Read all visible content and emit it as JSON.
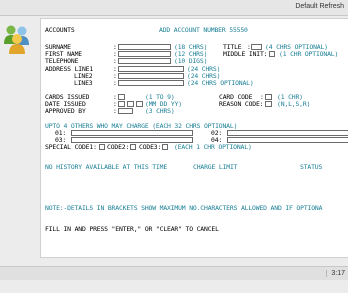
{
  "header": {
    "title": "Default Refresh"
  },
  "footer": {
    "time": "3:17"
  },
  "icon": {
    "name": "users-group-icon"
  },
  "screen": {
    "row_accounts": {
      "label": "ACCOUNTS",
      "info": "ADD ACCOUNT NUMBER 55550"
    },
    "surname": {
      "label": "SURNAME",
      "hint": "(18 CHRS)"
    },
    "title": {
      "label": "TITLE",
      "hint": "(4 CHRS OPTIONAL)"
    },
    "first_name": {
      "label": "FIRST NAME",
      "hint": "(12 CHRS)"
    },
    "middle_init": {
      "label": "MIDDLE INIT:",
      "hint": "(1 CHR OPTIONAL)"
    },
    "telephone": {
      "label": "TELEPHONE",
      "hint": "(10 DIGS)"
    },
    "address1": {
      "label": "ADDRESS LINE1",
      "hint": "(24 CHRS)"
    },
    "address2": {
      "label": "LINE2",
      "hint": "(24 CHRS)"
    },
    "address3": {
      "label": "LINE3",
      "hint": "(24 CHRS OPTIONAL)"
    },
    "cards_issued": {
      "label": "CARDS ISSUED",
      "hint": "(1 TO 9)"
    },
    "card_code": {
      "label": "CARD CODE",
      "hint": "(1 CHR)"
    },
    "date_issued": {
      "label": "DATE ISSUED",
      "hint": "(MM DD YY)"
    },
    "reason_code": {
      "label": "REASON CODE:",
      "hint": "(N,L,S,R)"
    },
    "approved_by": {
      "label": "APPROVED BY",
      "hint": "(3 CHRS)"
    },
    "others_header": "UPTO 4 OTHERS WHO MAY CHARGE (EACH 32 CHRS OPTIONAL)",
    "others": [
      "01:",
      "02:",
      "03:",
      "04:"
    ],
    "special_code1": "SPECIAL CODE1:",
    "code2": "CODE2:",
    "code3": "CODE3:",
    "special_hint": "(EACH 1 CHR OPTIONAL)",
    "history_line": "NO HISTORY AVAILABLE AT THIS TIME",
    "charge_limit": "CHARGE LIMIT",
    "status": "STATUS",
    "note": "NOTE:-DETAILS IN BRACKETS SHOW MAXIMUM NO.CHARACTERS ALLOWED AND IF OPTIONA",
    "instruction": "FILL IN AND PRESS \"ENTER,\" OR \"CLEAR\" TO CANCEL"
  },
  "fields": {
    "surname": "",
    "title": "",
    "first_name": "",
    "middle_init": "",
    "telephone": "",
    "address1": "",
    "address2": "",
    "address3": "",
    "cards_issued": "",
    "card_code": "",
    "date_mm": "",
    "date_dd": "",
    "date_yy": "",
    "reason_code": "",
    "approved_by": "",
    "other1": "",
    "other2": "",
    "other3": "",
    "other4": "",
    "code1": "",
    "code2": "",
    "code3": ""
  }
}
